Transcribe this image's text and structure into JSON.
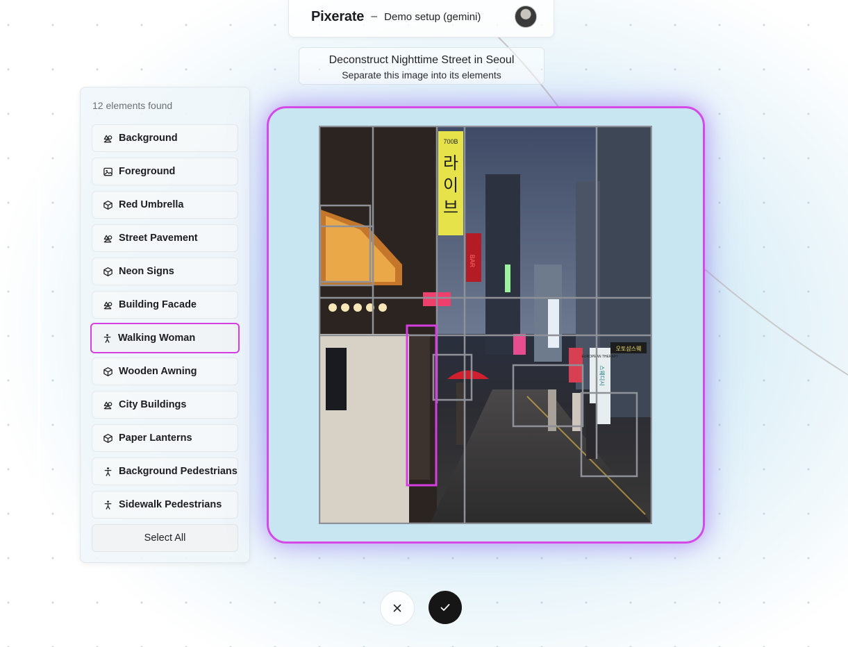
{
  "header": {
    "app_name": "Pixerate",
    "separator": "–",
    "subtitle": "Demo setup (gemini)"
  },
  "task": {
    "title": "Deconstruct Nighttime Street in Seoul",
    "description": "Separate this image into its elements"
  },
  "panel": {
    "count_text": "12 elements found",
    "select_all_label": "Select All",
    "items": [
      {
        "label": "Background",
        "icon": "scene-icon"
      },
      {
        "label": "Foreground",
        "icon": "image-icon"
      },
      {
        "label": "Red Umbrella",
        "icon": "cube-icon"
      },
      {
        "label": "Street Pavement",
        "icon": "scene-icon"
      },
      {
        "label": "Neon Signs",
        "icon": "cube-icon"
      },
      {
        "label": "Building Facade",
        "icon": "scene-icon"
      },
      {
        "label": "Walking Woman",
        "icon": "person-icon",
        "selected": true
      },
      {
        "label": "Wooden Awning",
        "icon": "cube-icon"
      },
      {
        "label": "City Buildings",
        "icon": "scene-icon"
      },
      {
        "label": "Paper Lanterns",
        "icon": "cube-icon"
      },
      {
        "label": "Background Pedestrians",
        "icon": "person-icon"
      },
      {
        "label": "Sidewalk Pedestrians",
        "icon": "person-icon"
      }
    ]
  },
  "canvas": {
    "accent_color": "#d54ae6",
    "selection_color": "#d53ee0",
    "box_color": "#8e9298"
  },
  "photo_signs": {
    "vertical_sign": [
      "라",
      "이",
      "브"
    ],
    "sign_top": "700B",
    "red_sign": "BAR",
    "right_sign": "스웨디시",
    "right_tag": "EUROPEAN THERAPY",
    "right_chip": "오토샵스웨"
  },
  "actions": {
    "cancel_icon": "close-icon",
    "confirm_icon": "check-icon"
  }
}
